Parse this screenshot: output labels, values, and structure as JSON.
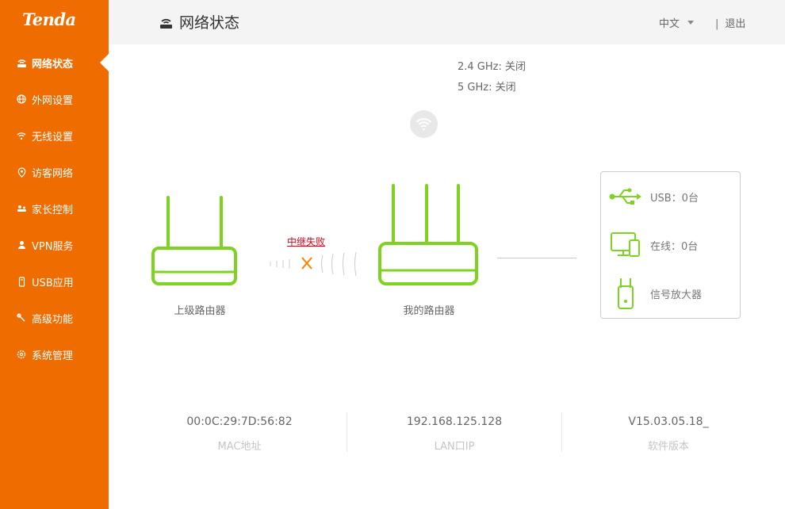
{
  "brand": {
    "logo": "Tenda",
    "accent": "#ef6c00"
  },
  "sidebar": {
    "items": [
      {
        "label": "网络状态",
        "icon": "router-status-icon",
        "active": true
      },
      {
        "label": "外网设置",
        "icon": "globe-icon"
      },
      {
        "label": "无线设置",
        "icon": "wifi-icon"
      },
      {
        "label": "访客网络",
        "icon": "guest-pin-icon"
      },
      {
        "label": "家长控制",
        "icon": "parental-control-icon"
      },
      {
        "label": "VPN服务",
        "icon": "vpn-user-icon"
      },
      {
        "label": "USB应用",
        "icon": "usb-icon"
      },
      {
        "label": "高级功能",
        "icon": "tools-icon"
      },
      {
        "label": "系统管理",
        "icon": "gear-icon"
      }
    ]
  },
  "header": {
    "title": "网络状态",
    "language": "中文",
    "separator": "|",
    "logout": "退出"
  },
  "wireless": {
    "band24": "2.4 GHz: 关闭",
    "band5": "5 GHz: 关闭"
  },
  "topology": {
    "upstream_label": "上级路由器",
    "relay_status": "中继失败",
    "my_router_label": "我的路由器",
    "device_color": "#7ed321",
    "fail_color": "#ff7f00"
  },
  "clients": {
    "usb": "USB：0台",
    "online": "在线：0台",
    "extender": "信号放大器"
  },
  "stats": {
    "mac_value": "00:0C:29:7D:56:82",
    "mac_label": "MAC地址",
    "lan_value": "192.168.125.128",
    "lan_label": "LAN口IP",
    "version_value": "V15.03.05.18_",
    "version_label": "软件版本"
  }
}
